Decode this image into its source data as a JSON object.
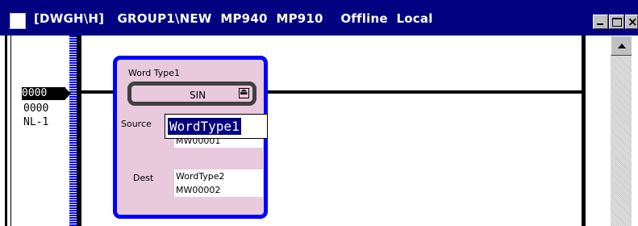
{
  "window": {
    "title": "[DWGH\\H]   GROUP1\\NEW  MP940  MP910    Offline  Local",
    "controls": {
      "minimize": "minimize",
      "maximize": "maximize",
      "close": "close"
    }
  },
  "ladder": {
    "left_tags": {
      "coil_tag": "0000",
      "line_number": "0000",
      "net_label": "NL-1"
    },
    "function_block": {
      "type_label": "Word Type1",
      "instruction": "SIN",
      "instruction_icon": "collapse-icon",
      "source_label": "Source",
      "source_edit_value": "WordType1",
      "source_address_partial": "MW00001",
      "dest_label": "Dest",
      "dest_name": "WordType2",
      "dest_address": "MW00002"
    }
  },
  "colors": {
    "titlebar": "#000080",
    "block_fill": "#e9c9dc",
    "block_border": "#0000ff",
    "rail_blue": "#0000ff"
  }
}
